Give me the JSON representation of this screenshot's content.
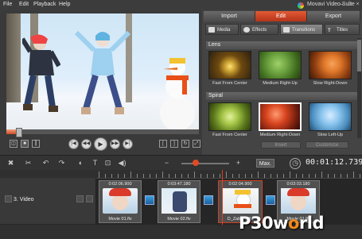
{
  "menubar": {
    "items": [
      "File",
      "Edit",
      "Playback",
      "Help"
    ],
    "app_title": "Movavi Video Suite"
  },
  "mode_tabs": [
    "Import",
    "Edit",
    "Export"
  ],
  "active_mode": "Edit",
  "sub_tabs": [
    "Media",
    "Effects",
    "Transitions",
    "Titles"
  ],
  "active_sub_tab": "Transitions",
  "transitions": {
    "sections": [
      {
        "name": "Lens",
        "items": [
          "Fast From Center",
          "Medium Right-Up",
          "Slow Right-Down"
        ]
      },
      {
        "name": "Spiral",
        "items": [
          "Fast From Center",
          "Medium Right-Down",
          "Slow Left-Up"
        ]
      }
    ],
    "selected": "Medium Right-Down",
    "insert_label": "Insert",
    "customize_label": "Customize"
  },
  "player": {
    "progress": 0.06
  },
  "timeline": {
    "max_label": "Max.",
    "timecode": "00:01:12.739",
    "track_name": "3. Video",
    "clips": [
      {
        "timecode": "0:02:06.900",
        "name": "Movie 01.flv"
      },
      {
        "timecode": "0:03:47.180",
        "name": "Movie 02.flv"
      },
      {
        "timecode": "0:02:04.900",
        "name": "D_Zabava.flv"
      },
      {
        "timecode": "0:03:03.180",
        "name": "Movie 01.flv"
      }
    ]
  },
  "watermark": {
    "part1": "P30w",
    "part2": "o",
    "part3": "rld"
  },
  "colors": {
    "accent": "#d8441f",
    "panel": "#444444",
    "timeline": "#262626"
  }
}
